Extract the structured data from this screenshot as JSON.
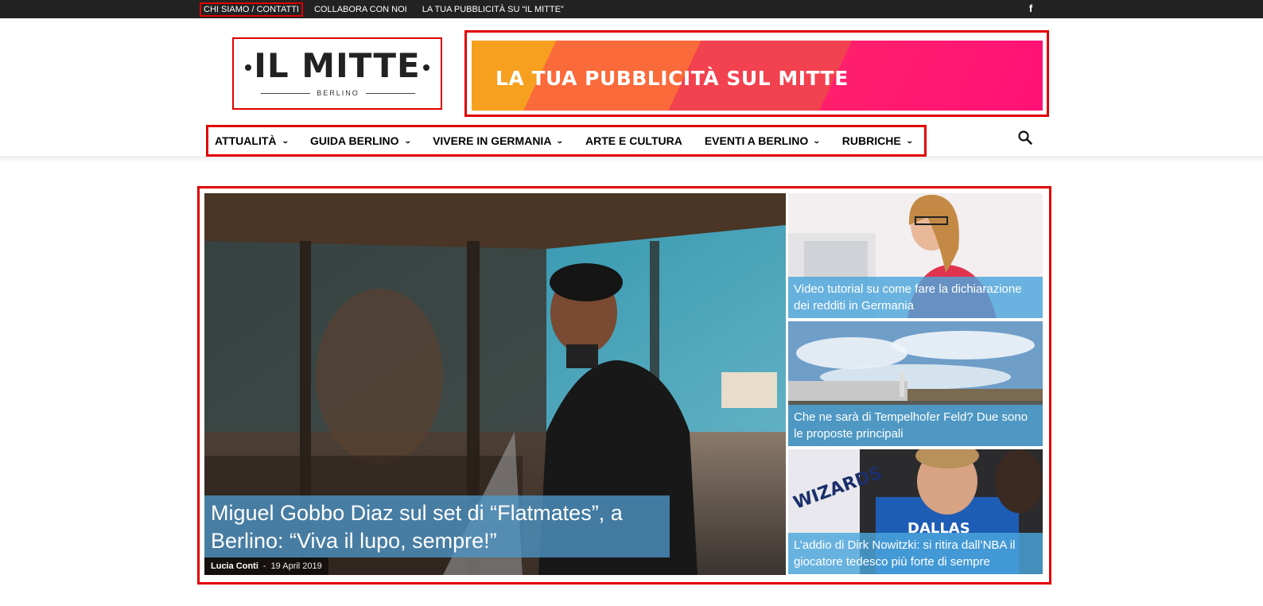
{
  "topbar": {
    "links": [
      "CHI SIAMO / CONTATTI",
      "COLLABORA CON NOI",
      "LA TUA PUBBLICITÀ SU “IL MITTE”"
    ],
    "social_icon": "facebook-icon"
  },
  "header": {
    "logo_text": "IL MITTE",
    "logo_sub": "BERLINO",
    "ad_text": "LA TUA PUBBLICITÀ SUL MITTE"
  },
  "nav": {
    "items": [
      {
        "label": "ATTUALITÀ",
        "has_dropdown": true
      },
      {
        "label": "GUIDA BERLINO",
        "has_dropdown": true
      },
      {
        "label": "VIVERE IN GERMANIA",
        "has_dropdown": true
      },
      {
        "label": "ARTE E CULTURA",
        "has_dropdown": false
      },
      {
        "label": "EVENTI A BERLINO",
        "has_dropdown": true
      },
      {
        "label": "RUBRICHE",
        "has_dropdown": true
      }
    ],
    "search_icon": "search-icon"
  },
  "featured": {
    "main": {
      "title": "Miguel Gobbo Diaz sul set di “Flatmates”, a Berlino: “Viva il lupo, sempre!”",
      "author": "Lucia Conti",
      "separator": "-",
      "date": "19 April 2019"
    },
    "side": [
      {
        "title": "Video tutorial su come fare la dichiarazione dei redditi in Germania"
      },
      {
        "title": "Che ne sarà di Tempelhofer Feld? Due sono le proposte principali"
      },
      {
        "title": "L’addio di Dirk Nowitzki: si ritira dall’NBA il giocatore tedesco più forte di sempre"
      }
    ]
  },
  "colors": {
    "highlight_outline": "#e00000",
    "topbar_bg": "#222222",
    "caption_blue": "#4ca6dc"
  }
}
